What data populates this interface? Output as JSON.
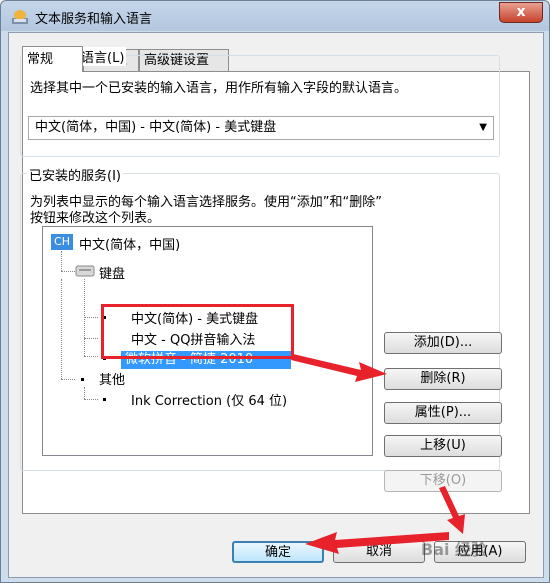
{
  "window": {
    "title": "文本服务和输入语言",
    "close_label": "x"
  },
  "tabs": [
    {
      "label": "常规"
    },
    {
      "label": "语言栏"
    },
    {
      "label": "高级键设置"
    }
  ],
  "default_language": {
    "group_label": "默认输入语言(L)",
    "description": "选择其中一个已安装的输入语言，用作所有输入字段的默认语言。",
    "selected": "中文(简体，中国) - 中文(简体) - 美式键盘"
  },
  "installed_services": {
    "group_label": "已安装的服务(I)",
    "description_line1": "为列表中显示的每个输入语言选择服务。使用“添加”和“删除”",
    "description_line2": "按钮来修改这个列表。",
    "language_badge": "CH",
    "language": "中文(简体，中国)",
    "keyboard_label": "键盘",
    "keyboard_items": [
      "中文(简体) - 美式键盘",
      "中文 - QQ拼音输入法",
      "微软拼音 - 简捷 2010"
    ],
    "other_label": "其他",
    "other_items": [
      "Ink Correction (仅 64 位)"
    ]
  },
  "buttons": {
    "add": "添加(D)...",
    "remove": "删除(R)",
    "properties": "属性(P)...",
    "move_up": "上移(U)",
    "move_down": "下移(O)",
    "ok": "确定",
    "cancel": "取消",
    "apply": "应用(A)"
  },
  "watermark": "Bai 经验",
  "colors": {
    "annotation_red": "#e8222a",
    "selection_blue": "#3399ff"
  }
}
